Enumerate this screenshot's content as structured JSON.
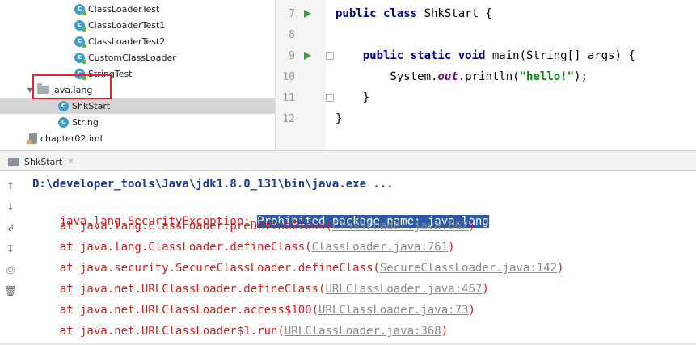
{
  "project_tree": {
    "items": [
      {
        "label": "ClassLoaderTest",
        "icon": "java-class-icon"
      },
      {
        "label": "ClassLoaderTest1",
        "icon": "java-class-icon"
      },
      {
        "label": "ClassLoaderTest2",
        "icon": "java-class-icon"
      },
      {
        "label": "CustomClassLoader",
        "icon": "java-class-icon"
      },
      {
        "label": "StringTest",
        "icon": "java-class-icon"
      },
      {
        "label": "java.lang",
        "icon": "package-folder-icon",
        "expanded": true,
        "highlighted": true
      },
      {
        "label": "ShkStart",
        "icon": "java-class-icon",
        "selected": true
      },
      {
        "label": "String",
        "icon": "java-class-icon"
      },
      {
        "label": "chapter02.iml",
        "icon": "module-file-icon"
      }
    ],
    "highlight_color": "#e3262e"
  },
  "editor": {
    "lines": [
      {
        "number": "7",
        "parts": [
          {
            "t": "public class ",
            "c": "kw"
          },
          {
            "t": "ShkStart {",
            "c": ""
          }
        ]
      },
      {
        "number": "8",
        "parts": []
      },
      {
        "number": "9",
        "parts": [
          {
            "t": "    ",
            "c": ""
          },
          {
            "t": "public static void ",
            "c": "kw"
          },
          {
            "t": "main(String[] args) {",
            "c": ""
          }
        ]
      },
      {
        "number": "10",
        "parts": [
          {
            "t": "        System.",
            "c": ""
          },
          {
            "t": "out",
            "c": "static-ref"
          },
          {
            "t": ".println(",
            "c": ""
          },
          {
            "t": "\"hello!\"",
            "c": "str"
          },
          {
            "t": ");",
            "c": ""
          }
        ]
      },
      {
        "number": "11",
        "parts": [
          {
            "t": "    }",
            "c": ""
          }
        ]
      },
      {
        "number": "12",
        "parts": [
          {
            "t": "}",
            "c": ""
          }
        ]
      }
    ],
    "run_markers": [
      "7",
      "9"
    ],
    "fold_markers": [
      "9",
      "11"
    ]
  },
  "run_panel": {
    "tab_label": "ShkStart",
    "tools": [
      "up-arrow-icon",
      "down-arrow-icon",
      "soft-wrap-icon",
      "scroll-to-end-icon",
      "print-icon",
      "trash-icon"
    ],
    "command_line": "D:\\developer_tools\\Java\\jdk1.8.0_131\\bin\\java.exe ...",
    "exception": {
      "prefix": "java.lang.SecurityException: ",
      "message": "Prohibited package name: java.lang"
    },
    "stack": [
      {
        "text": "    at java.lang.ClassLoader.preDefineClass(",
        "link": "ClassLoader.java:662",
        "suffix": ")"
      },
      {
        "text": "    at java.lang.ClassLoader.defineClass(",
        "link": "ClassLoader.java:761",
        "suffix": ")"
      },
      {
        "text": "    at java.security.SecureClassLoader.defineClass(",
        "link": "SecureClassLoader.java:142",
        "suffix": ")"
      },
      {
        "text": "    at java.net.URLClassLoader.defineClass(",
        "link": "URLClassLoader.java:467",
        "suffix": ")"
      },
      {
        "text": "    at java.net.URLClassLoader.access$100(",
        "link": "URLClassLoader.java:73",
        "suffix": ")"
      },
      {
        "text": "    at java.net.URLClassLoader$1.run(",
        "link": "URLClassLoader.java:368",
        "suffix": ")"
      }
    ]
  }
}
